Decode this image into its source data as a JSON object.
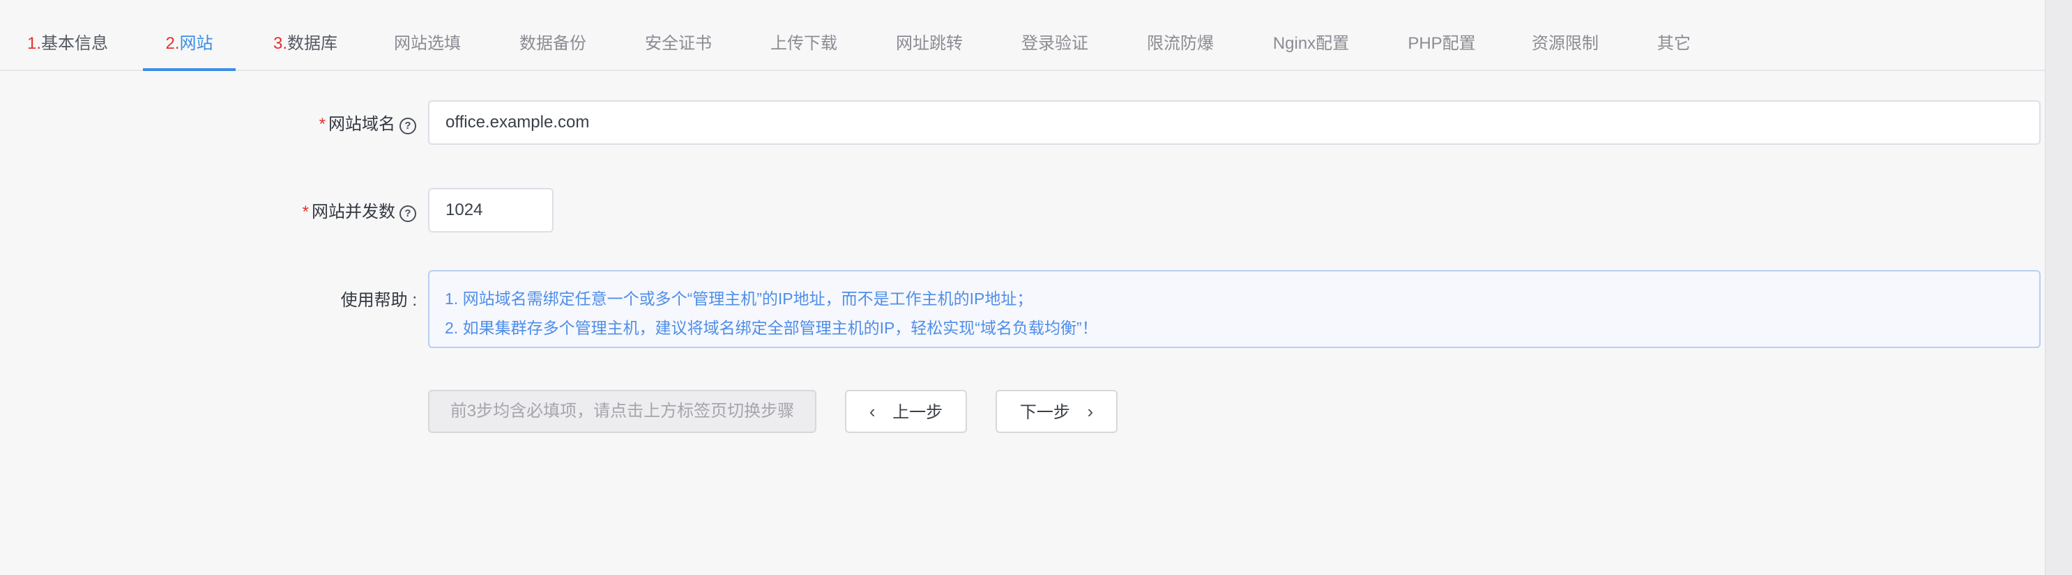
{
  "tabs": [
    {
      "num": "1.",
      "label": "基本信息"
    },
    {
      "num": "2.",
      "label": "网站"
    },
    {
      "num": "3.",
      "label": "数据库"
    },
    {
      "label": "网站选填"
    },
    {
      "label": "数据备份"
    },
    {
      "label": "安全证书"
    },
    {
      "label": "上传下载"
    },
    {
      "label": "网址跳转"
    },
    {
      "label": "登录验证"
    },
    {
      "label": "限流防爆"
    },
    {
      "label": "Nginx配置"
    },
    {
      "label": "PHP配置"
    },
    {
      "label": "资源限制"
    },
    {
      "label": "其它"
    }
  ],
  "active_tab_index": 1,
  "form": {
    "required_mark": "*",
    "domain_label": "网站域名",
    "domain_value": "office.example.com",
    "concurrency_label": "网站并发数",
    "concurrency_value": "1024",
    "help_label": "使用帮助 :",
    "help_lines": [
      "1. 网站域名需绑定任意一个或多个“管理主机”的IP地址，而不是工作主机的IP地址；",
      "2. 如果集群存多个管理主机，建议将域名绑定全部管理主机的IP，轻松实现“域名负载均衡”！"
    ]
  },
  "buttons": {
    "hint": "前3步均含必填项，请点击上方标签页切换步骤",
    "prev": "上一步",
    "next": "下一步"
  },
  "icons": {
    "help": "question-circle-icon",
    "prev": "chevron-left-icon",
    "next": "chevron-right-icon"
  },
  "colors": {
    "accent": "#3a8ee6",
    "required": "#e4322b",
    "help_text": "#4f8ee8"
  }
}
